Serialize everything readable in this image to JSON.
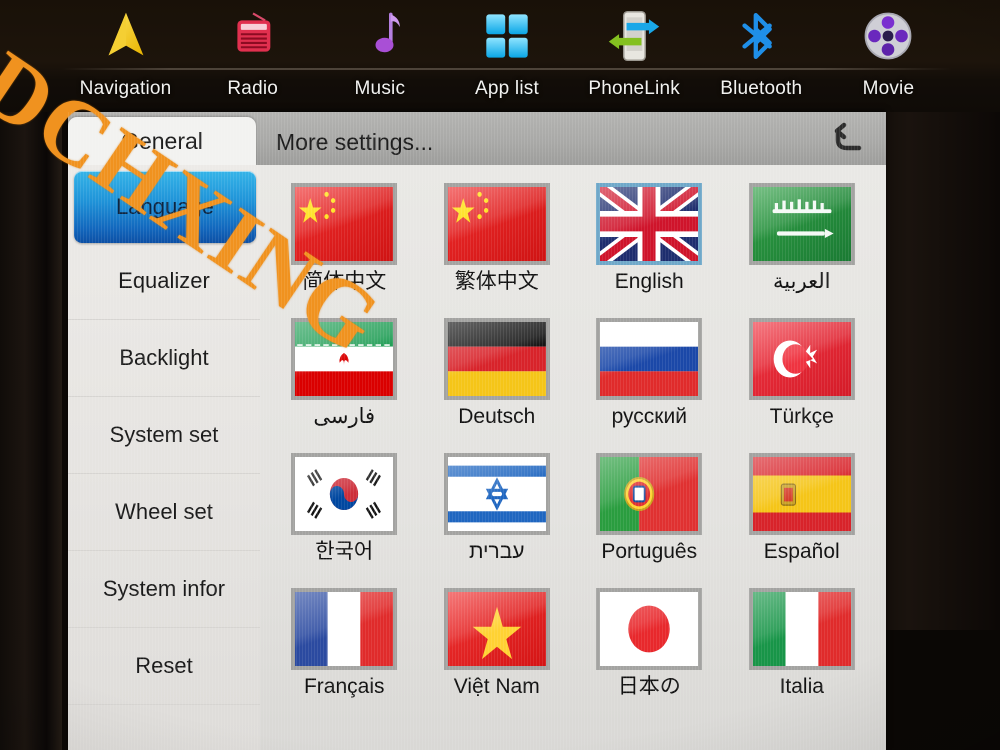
{
  "topnav": {
    "items": [
      {
        "label": "Navigation",
        "icon": "navigation-arrow-icon"
      },
      {
        "label": "Radio",
        "icon": "radio-icon"
      },
      {
        "label": "Music",
        "icon": "music-note-icon"
      },
      {
        "label": "App list",
        "icon": "app-grid-icon"
      },
      {
        "label": "PhoneLink",
        "icon": "phonelink-icon"
      },
      {
        "label": "Bluetooth",
        "icon": "bluetooth-icon"
      },
      {
        "label": "Movie",
        "icon": "movie-reel-icon"
      }
    ]
  },
  "tabs": [
    {
      "label": "General",
      "active": true
    },
    {
      "label": "More settings...",
      "active": false
    }
  ],
  "back_button": {
    "icon": "back-arrow-icon",
    "label": "↶"
  },
  "sidebar": {
    "items": [
      {
        "label": "Language",
        "active": true
      },
      {
        "label": "Equalizer",
        "active": false
      },
      {
        "label": "Backlight",
        "active": false
      },
      {
        "label": "System set",
        "active": false
      },
      {
        "label": "Wheel set",
        "active": false
      },
      {
        "label": "System infor",
        "active": false
      },
      {
        "label": "Reset",
        "active": false
      }
    ]
  },
  "languages": [
    {
      "label": "简体中文",
      "flag": "china",
      "selected": false
    },
    {
      "label": "繁体中文",
      "flag": "china",
      "selected": false
    },
    {
      "label": "English",
      "flag": "uk",
      "selected": true
    },
    {
      "label": "العربية",
      "flag": "saudi",
      "selected": false
    },
    {
      "label": "فارسی",
      "flag": "iran",
      "selected": false
    },
    {
      "label": "Deutsch",
      "flag": "germany",
      "selected": false
    },
    {
      "label": "русский",
      "flag": "russia",
      "selected": false
    },
    {
      "label": "Türkçe",
      "flag": "turkey",
      "selected": false
    },
    {
      "label": "한국어",
      "flag": "korea",
      "selected": false
    },
    {
      "label": "עברית",
      "flag": "israel",
      "selected": false
    },
    {
      "label": "Português",
      "flag": "portugal",
      "selected": false
    },
    {
      "label": "Español",
      "flag": "spain",
      "selected": false
    },
    {
      "label": "Français",
      "flag": "france",
      "selected": false
    },
    {
      "label": "Việt Nam",
      "flag": "vietnam",
      "selected": false
    },
    {
      "label": "日本の",
      "flag": "japan",
      "selected": false
    },
    {
      "label": "Italia",
      "flag": "italy",
      "selected": false
    }
  ],
  "watermark": {
    "text": "DCHXING",
    "color": "#f0921f"
  },
  "colors": {
    "accent_selected": "#1f93d8",
    "window_bg": "#e3e2df",
    "tabbar_bg": "#a9a9a7",
    "topnav_bg": "#1d140b",
    "flag_border": "#a3a3a1",
    "flag_border_selected": "#6fa8c9"
  }
}
